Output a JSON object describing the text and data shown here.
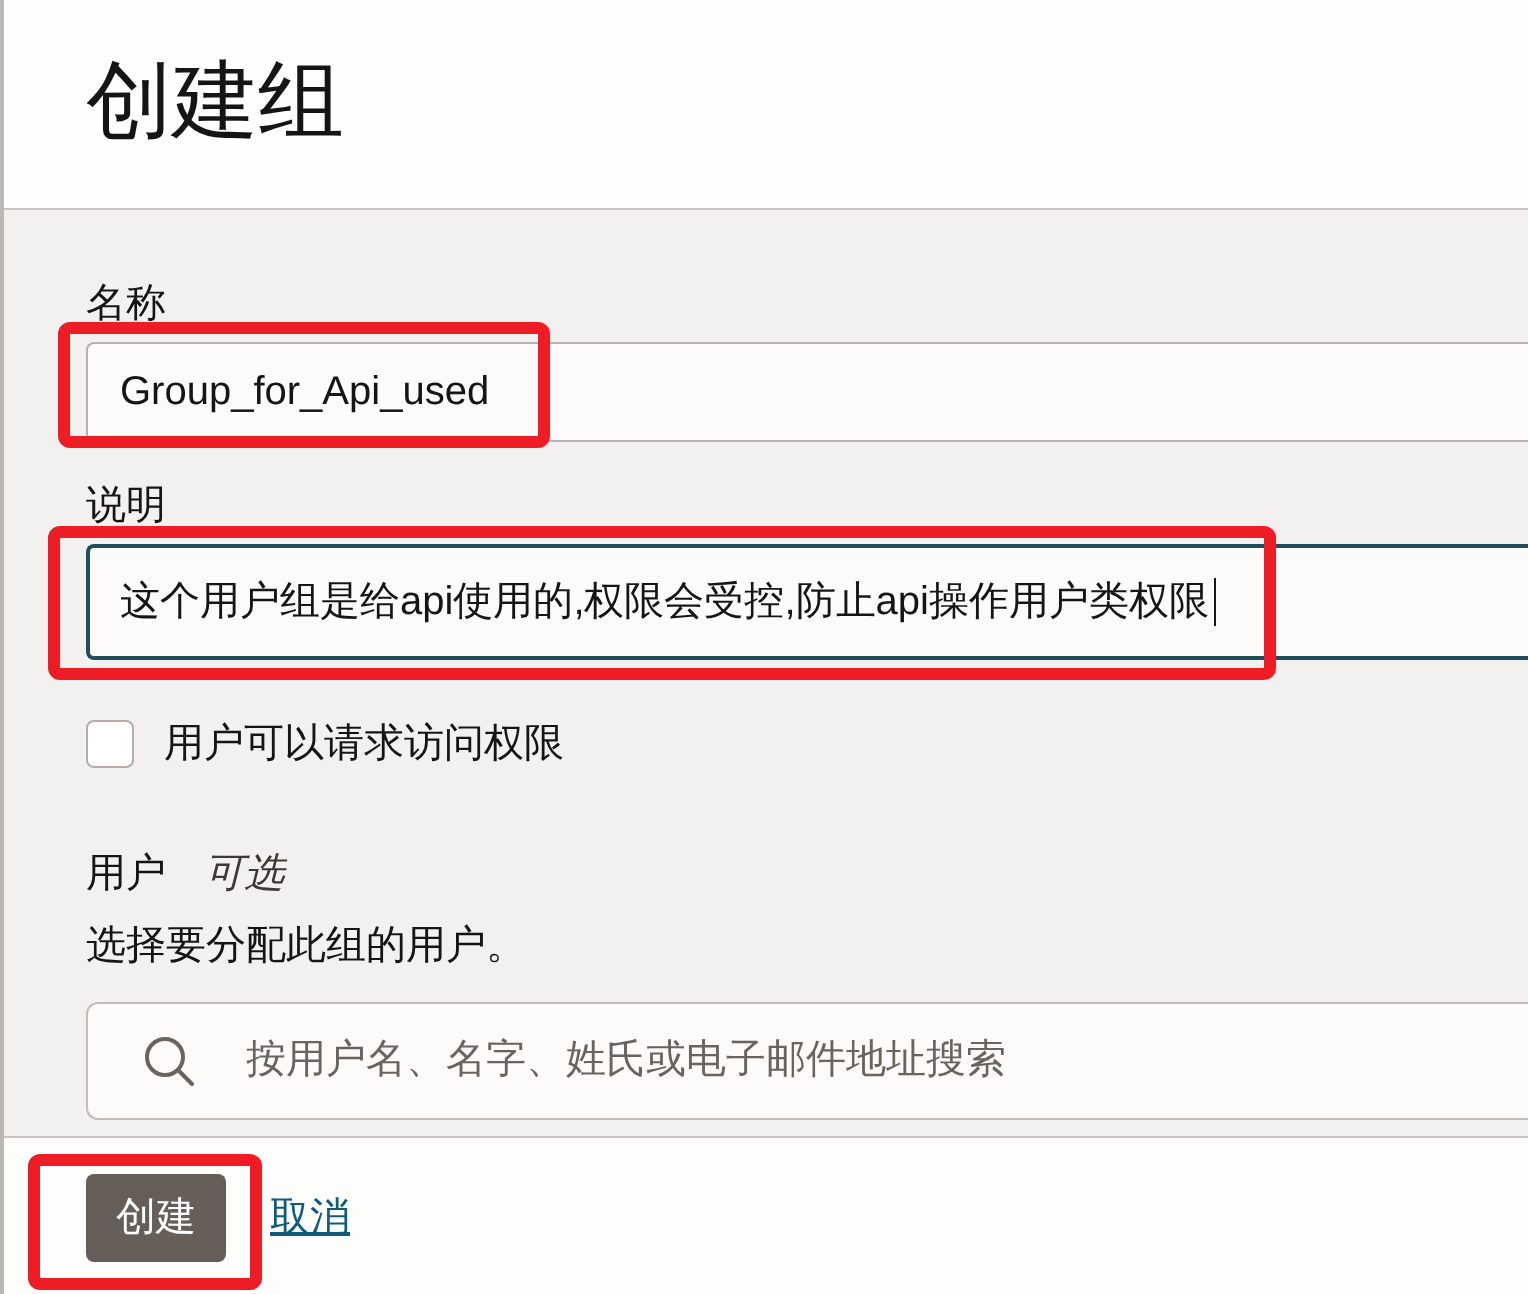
{
  "header": {
    "title": "创建组"
  },
  "form": {
    "name_field": {
      "label": "名称",
      "value": "Group_for_Api_used",
      "highlighted": true,
      "focused": false
    },
    "description_field": {
      "label": "说明",
      "value": "这个用户组是给api使用的,权限会受控,防止api操作用户类权限",
      "highlighted": true,
      "focused": true
    },
    "request_access": {
      "label": "用户可以请求访问权限",
      "checked": false
    },
    "users": {
      "label": "用户",
      "optional_note": "可选",
      "help": "选择要分配此组的用户。",
      "search": {
        "placeholder": "按用户名、名字、姓氏或电子邮件地址搜索"
      }
    }
  },
  "footer": {
    "buttons": [
      {
        "kind": "primary",
        "label": "创建",
        "highlighted": true
      },
      {
        "kind": "link",
        "label": "取消",
        "highlighted": false
      }
    ]
  }
}
